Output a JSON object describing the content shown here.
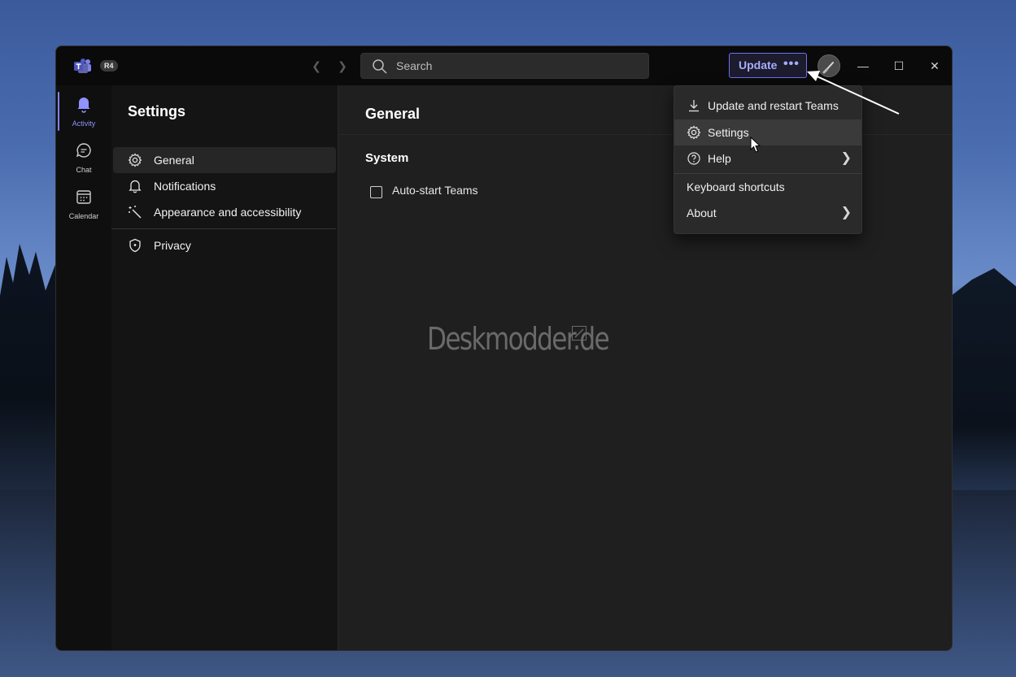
{
  "titlebar": {
    "ring_badge": "R4",
    "search_placeholder": "Search",
    "update_label": "Update",
    "update_more": "•••"
  },
  "rail": {
    "items": [
      {
        "label": "Activity",
        "icon": "bell-icon",
        "active": true
      },
      {
        "label": "Chat",
        "icon": "chat-icon",
        "active": false
      },
      {
        "label": "Calendar",
        "icon": "calendar-icon",
        "active": false
      }
    ]
  },
  "settings": {
    "title": "Settings",
    "items": [
      {
        "label": "General",
        "icon": "gear-icon",
        "selected": true
      },
      {
        "label": "Notifications",
        "icon": "bell-icon",
        "selected": false
      },
      {
        "label": "Appearance and accessibility",
        "icon": "sparkle-wand-icon",
        "selected": false
      },
      {
        "label": "Privacy",
        "icon": "shield-icon",
        "selected": false
      }
    ]
  },
  "main": {
    "title": "General",
    "section": "System",
    "checkbox_label": "Auto-start Teams",
    "checkbox_checked": false,
    "watermark": "Deskmodder.de"
  },
  "dropdown": {
    "items": [
      {
        "label": "Update and restart Teams",
        "icon": "download-icon"
      },
      {
        "label": "Settings",
        "icon": "gear-icon"
      },
      {
        "label": "Help",
        "icon": "help-circle-icon",
        "submenu": true
      },
      {
        "label": "Keyboard shortcuts"
      },
      {
        "label": "About",
        "submenu": true
      }
    ]
  },
  "colors": {
    "accent": "#7f85f5",
    "update_text": "#a9abff",
    "window_bg": "#1f1f1f",
    "sidebar_bg": "#141414"
  }
}
